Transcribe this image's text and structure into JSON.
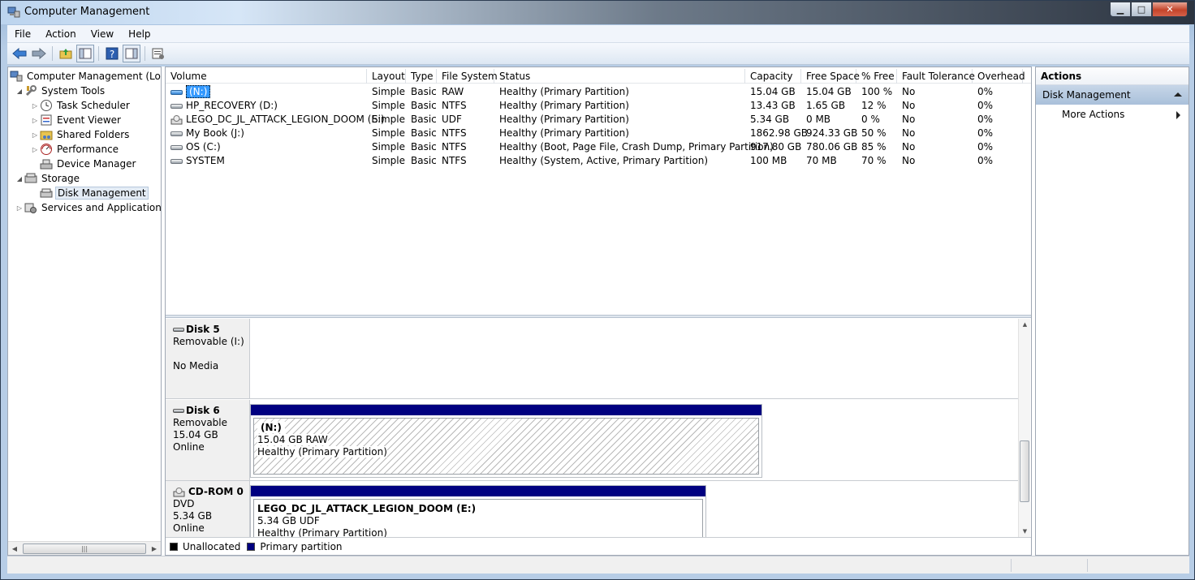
{
  "window": {
    "title": "Computer Management"
  },
  "menu": [
    "File",
    "Action",
    "View",
    "Help"
  ],
  "toolbar": [
    "back-icon",
    "forward-icon",
    "up-folder-icon",
    "show-hide-tree-icon",
    "help-icon",
    "console-icon",
    "properties-icon"
  ],
  "tree": {
    "items": [
      {
        "label": "Computer Management (Local",
        "level": 0,
        "icon": "computer-management-icon",
        "expander": ""
      },
      {
        "label": "System Tools",
        "level": 1,
        "icon": "tools-icon",
        "expander": "▲"
      },
      {
        "label": "Task Scheduler",
        "level": 2,
        "icon": "clock-icon",
        "expander": "▷"
      },
      {
        "label": "Event Viewer",
        "level": 2,
        "icon": "event-viewer-icon",
        "expander": "▷"
      },
      {
        "label": "Shared Folders",
        "level": 2,
        "icon": "shared-folder-icon",
        "expander": "▷"
      },
      {
        "label": "Performance",
        "level": 2,
        "icon": "performance-icon",
        "expander": "▷"
      },
      {
        "label": "Device Manager",
        "level": 2,
        "icon": "device-manager-icon",
        "expander": ""
      },
      {
        "label": "Storage",
        "level": 1,
        "icon": "storage-icon",
        "expander": "▲"
      },
      {
        "label": "Disk Management",
        "level": 2,
        "icon": "disk-management-icon",
        "expander": "",
        "selected": true
      },
      {
        "label": "Services and Applications",
        "level": 1,
        "icon": "services-icon",
        "expander": "▷"
      }
    ]
  },
  "volumes": {
    "columns": [
      "Volume",
      "Layout",
      "Type",
      "File System",
      "Status",
      "Capacity",
      "Free Space",
      "% Free",
      "Fault Tolerance",
      "Overhead"
    ],
    "rows": [
      {
        "icon": "blue",
        "volume": "(N:)",
        "layout": "Simple",
        "type": "Basic",
        "fs": "RAW",
        "status": "Healthy (Primary Partition)",
        "capacity": "15.04 GB",
        "free": "15.04 GB",
        "pct": "100 %",
        "fault": "No",
        "overhead": "0%",
        "selected": true
      },
      {
        "icon": "disk",
        "volume": "HP_RECOVERY (D:)",
        "layout": "Simple",
        "type": "Basic",
        "fs": "NTFS",
        "status": "Healthy (Primary Partition)",
        "capacity": "13.43 GB",
        "free": "1.65 GB",
        "pct": "12 %",
        "fault": "No",
        "overhead": "0%"
      },
      {
        "icon": "cd",
        "volume": "LEGO_DC_JL_ATTACK_LEGION_DOOM (E:)",
        "layout": "Simple",
        "type": "Basic",
        "fs": "UDF",
        "status": "Healthy (Primary Partition)",
        "capacity": "5.34 GB",
        "free": "0 MB",
        "pct": "0 %",
        "fault": "No",
        "overhead": "0%"
      },
      {
        "icon": "disk",
        "volume": "My Book (J:)",
        "layout": "Simple",
        "type": "Basic",
        "fs": "NTFS",
        "status": "Healthy (Primary Partition)",
        "capacity": "1862.98 GB",
        "free": "924.33 GB",
        "pct": "50 %",
        "fault": "No",
        "overhead": "0%"
      },
      {
        "icon": "disk",
        "volume": "OS (C:)",
        "layout": "Simple",
        "type": "Basic",
        "fs": "NTFS",
        "status": "Healthy (Boot, Page File, Crash Dump, Primary Partition)",
        "capacity": "917.80 GB",
        "free": "780.06 GB",
        "pct": "85 %",
        "fault": "No",
        "overhead": "0%"
      },
      {
        "icon": "disk",
        "volume": "SYSTEM",
        "layout": "Simple",
        "type": "Basic",
        "fs": "NTFS",
        "status": "Healthy (System, Active, Primary Partition)",
        "capacity": "100 MB",
        "free": "70 MB",
        "pct": "70 %",
        "fault": "No",
        "overhead": "0%"
      }
    ]
  },
  "disks": {
    "disk5": {
      "name": "Disk 5",
      "line1": "Removable (I:)",
      "line2": "",
      "line3": "No Media"
    },
    "disk6": {
      "name": "Disk 6",
      "line1": "Removable",
      "line2": "15.04 GB",
      "line3": "Online",
      "partition": {
        "name": "(N:)",
        "size": "15.04 GB RAW",
        "status": "Healthy (Primary Partition)"
      }
    },
    "cdrom0": {
      "name": "CD-ROM 0",
      "line1": "DVD",
      "line2": "5.34 GB",
      "line3": "Online",
      "partition": {
        "name": "LEGO_DC_JL_ATTACK_LEGION_DOOM  (E:)",
        "size": "5.34 GB UDF",
        "status": "Healthy (Primary Partition)"
      }
    }
  },
  "legend": {
    "unallocated": "Unallocated",
    "primary": "Primary partition"
  },
  "actions": {
    "header": "Actions",
    "section": "Disk Management",
    "more": "More Actions"
  },
  "colors": {
    "primary_partition": "#000080",
    "unallocated": "#000000",
    "selection": "#3399ff"
  }
}
